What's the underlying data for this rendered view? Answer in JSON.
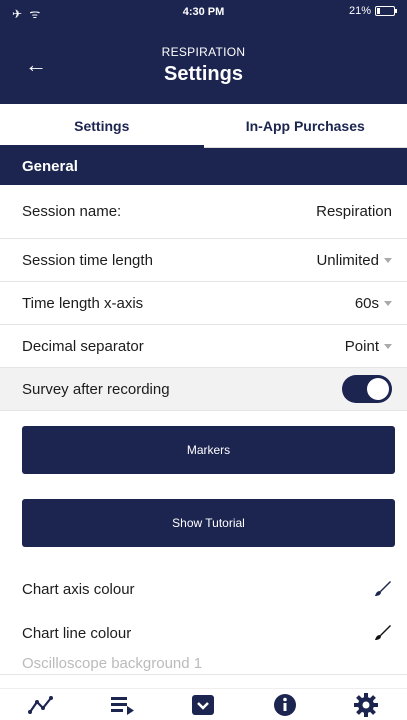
{
  "status": {
    "left_icons": "✈ ᯤ",
    "time": "4:30 PM",
    "battery": "21%"
  },
  "header": {
    "back_icon": "←",
    "subtitle": "RESPIRATION",
    "title": "Settings"
  },
  "tabs": [
    {
      "label": "Settings",
      "active": true
    },
    {
      "label": "In-App Purchases",
      "active": false
    }
  ],
  "section": {
    "title": "General"
  },
  "rows": {
    "session_name": {
      "label": "Session name:",
      "value": "Respiration"
    },
    "session_time": {
      "label": "Session time length",
      "value": "Unlimited"
    },
    "time_axis": {
      "label": "Time length x-axis",
      "value": "60s"
    },
    "decimal": {
      "label": "Decimal separator",
      "value": "Point"
    },
    "survey": {
      "label": "Survey after recording",
      "enabled": true
    }
  },
  "buttons": {
    "markers": "Markers",
    "tutorial": "Show Tutorial"
  },
  "colours": {
    "axis": {
      "label": "Chart axis colour",
      "color": "#1c2450"
    },
    "line": {
      "label": "Chart line colour",
      "color": "#111111"
    },
    "osc": {
      "label": "Oscilloscope background 1"
    }
  },
  "bottom_nav": [
    {
      "name": "chart-icon"
    },
    {
      "name": "list-icon"
    },
    {
      "name": "archive-icon"
    },
    {
      "name": "info-icon"
    },
    {
      "name": "settings-gear-icon"
    }
  ],
  "theme": {
    "primary": "#1c2450"
  }
}
